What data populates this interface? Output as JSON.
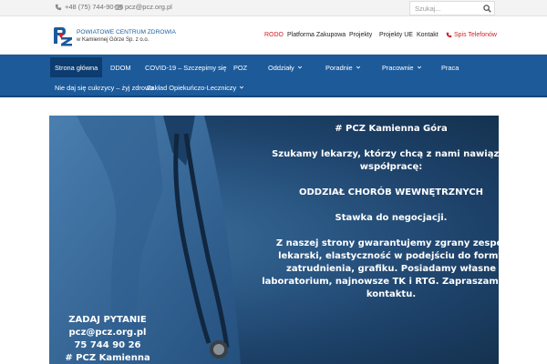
{
  "topbar": {
    "phone": "+48 (75) 744-90-36",
    "email": "pcz@pcz.org.pl",
    "search_placeholder": "Szukaj..."
  },
  "header": {
    "org_line1": "POWIATOWE CENTRUM ZDROWIA",
    "org_line2": "w Kamiennej Górze Sp. z o.o.",
    "nav": [
      {
        "label": "RODO"
      },
      {
        "label": "Platforma Zakupowa"
      },
      {
        "label": "Projekty"
      },
      {
        "label": "Projekty UE"
      },
      {
        "label": "Kontakt"
      },
      {
        "label": "Spis Telefonów"
      }
    ]
  },
  "mainnav": {
    "items": [
      {
        "label": "Strona główna",
        "active": true
      },
      {
        "label": "DDOM"
      },
      {
        "label": "COVID-19 – Szczepimy się"
      },
      {
        "label": "POZ"
      },
      {
        "label": "Oddziały",
        "dropdown": true
      },
      {
        "label": "Poradnie",
        "dropdown": true
      },
      {
        "label": "Pracownie",
        "dropdown": true
      },
      {
        "label": "Praca"
      },
      {
        "label": "Nie daj się cukrzycy – żyj zdrowo"
      },
      {
        "label": "Zakład Opiekuńczo-Leczniczy",
        "dropdown": true
      }
    ]
  },
  "hero": {
    "lines": [
      "# PCZ Kamienna Góra",
      "Szukamy lekarzy, którzy chcą z nami nawiązać współpracę:",
      "ODDZIAŁ CHORÓB WEWNĘTRZNYCH",
      "Stawka do negocjacji.",
      "Z naszej strony gwarantujemy zgrany zespół lekarski, elastyczność w podejściu do formy zatrudnienia, grafiku. Posiadamy własne laboratorium, najnowsze TK i RTG. Zapraszamy do kontaktu."
    ],
    "left_lines": [
      "ZADAJ PYTANIE",
      "pcz@pcz.org.pl",
      "75 744 90 26",
      "# PCZ Kamienna Góra"
    ]
  },
  "colors": {
    "brand_blue": "#1c5a9a",
    "nav_active": "#0d3c70",
    "accent_red": "#d12127"
  }
}
